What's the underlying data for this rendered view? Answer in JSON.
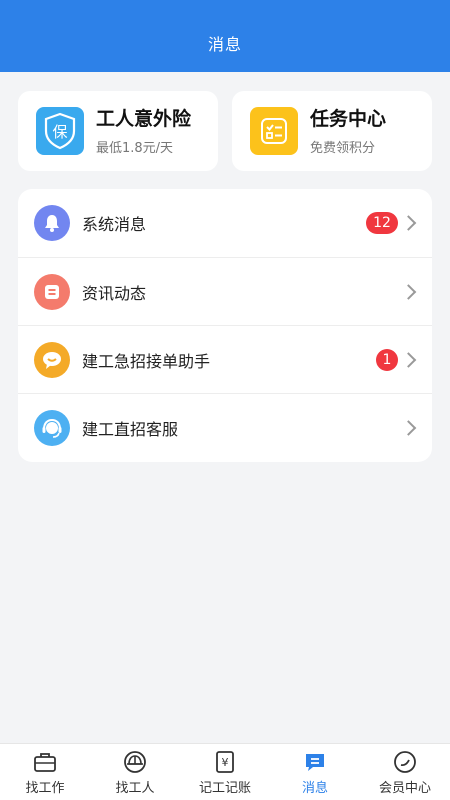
{
  "header": {
    "title": "消息"
  },
  "cards": [
    {
      "title": "工人意外险",
      "subtitle": "最低1.8元/天",
      "icon": "insurance-shield-icon",
      "icon_text": "保",
      "color": "#39a9ee"
    },
    {
      "title": "任务中心",
      "subtitle": "免费领积分",
      "icon": "task-checklist-icon",
      "color": "#fcc21b"
    }
  ],
  "messages": [
    {
      "label": "系统消息",
      "icon": "bell-icon",
      "badge": "12"
    },
    {
      "label": "资讯动态",
      "icon": "news-icon"
    },
    {
      "label": "建工急招接单助手",
      "icon": "chat-bubble-icon",
      "badge": "1"
    },
    {
      "label": "建工直招客服",
      "icon": "customer-service-icon"
    }
  ],
  "tabs": [
    {
      "label": "找工作",
      "icon": "briefcase-icon"
    },
    {
      "label": "找工人",
      "icon": "hardhat-icon"
    },
    {
      "label": "记工记账",
      "icon": "ledger-icon",
      "icon_text": "¥"
    },
    {
      "label": "消息",
      "icon": "message-icon",
      "active": true
    },
    {
      "label": "会员中心",
      "icon": "member-icon"
    }
  ],
  "colors": {
    "primary": "#2d81e8",
    "badge": "#f0373f",
    "background": "#f3f4f6"
  }
}
